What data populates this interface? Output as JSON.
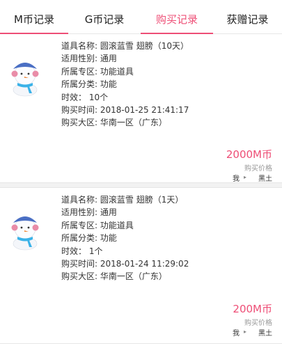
{
  "tabs": [
    {
      "label": "M币记录",
      "active": false
    },
    {
      "label": "G币记录",
      "active": false
    },
    {
      "label": "购买记录",
      "active": true
    },
    {
      "label": "获赠记录",
      "active": false
    }
  ],
  "records": [
    {
      "icon": "snowman-icon",
      "name_label": "道具名称:",
      "name": "圆滚蓝雪 翅膀（10天）",
      "gender_label": "适用性别:",
      "gender": "通用",
      "zone_label": "所属专区:",
      "zone": "功能道具",
      "category_label": "所属分类:",
      "category": "功能",
      "duration_label": "时效：",
      "duration": "10个",
      "time_label": "购买时间:",
      "time": "2018-01-25 21:41:17",
      "region_label": "购买大区:",
      "region": "华南一区（广东）",
      "price": "2000M币",
      "price_label": "购买价格",
      "buyer": "我",
      "recipient": "黑土"
    },
    {
      "icon": "snowman-icon",
      "name_label": "道具名称:",
      "name": "圆滚蓝雪 翅膀（1天）",
      "gender_label": "适用性别:",
      "gender": "通用",
      "zone_label": "所属专区:",
      "zone": "功能道具",
      "category_label": "所属分类:",
      "category": "功能",
      "duration_label": "时效：",
      "duration": "1个",
      "time_label": "购买时间:",
      "time": "2018-01-24 11:29:02",
      "region_label": "购买大区:",
      "region": "华南一区（广东）",
      "price": "200M币",
      "price_label": "购买价格",
      "buyer": "我",
      "recipient": "黑土"
    }
  ],
  "colors": {
    "accent": "#ee4e76",
    "text": "#333333",
    "muted": "#999999"
  }
}
